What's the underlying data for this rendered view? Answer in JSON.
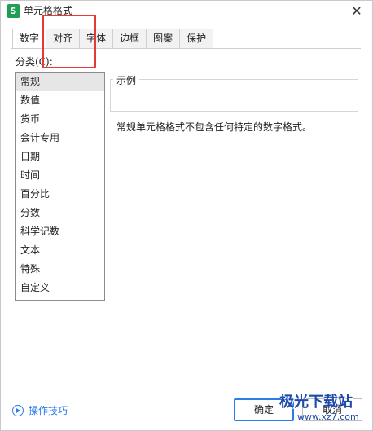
{
  "window": {
    "title": "单元格格式",
    "app_icon_letter": "S",
    "close_glyph": "✕"
  },
  "tabs": [
    {
      "label": "数字",
      "active": true
    },
    {
      "label": "对齐",
      "active": false
    },
    {
      "label": "字体",
      "active": false
    },
    {
      "label": "边框",
      "active": false
    },
    {
      "label": "图案",
      "active": false
    },
    {
      "label": "保护",
      "active": false
    }
  ],
  "number_panel": {
    "category_label": "分类(C):",
    "categories": [
      "常规",
      "数值",
      "货币",
      "会计专用",
      "日期",
      "时间",
      "百分比",
      "分数",
      "科学记数",
      "文本",
      "特殊",
      "自定义"
    ],
    "selected_category": "常规",
    "sample_legend": "示例",
    "description": "常规单元格格式不包含任何特定的数字格式。"
  },
  "footer": {
    "tips_label": "操作技巧",
    "ok_label": "确定",
    "cancel_label": "取消"
  },
  "watermark": {
    "main": "极光下载站",
    "sub": "www.xz7.com"
  },
  "colors": {
    "accent": "#2b7de9",
    "highlight_box": "#e53935",
    "app_icon": "#1f9e54"
  }
}
